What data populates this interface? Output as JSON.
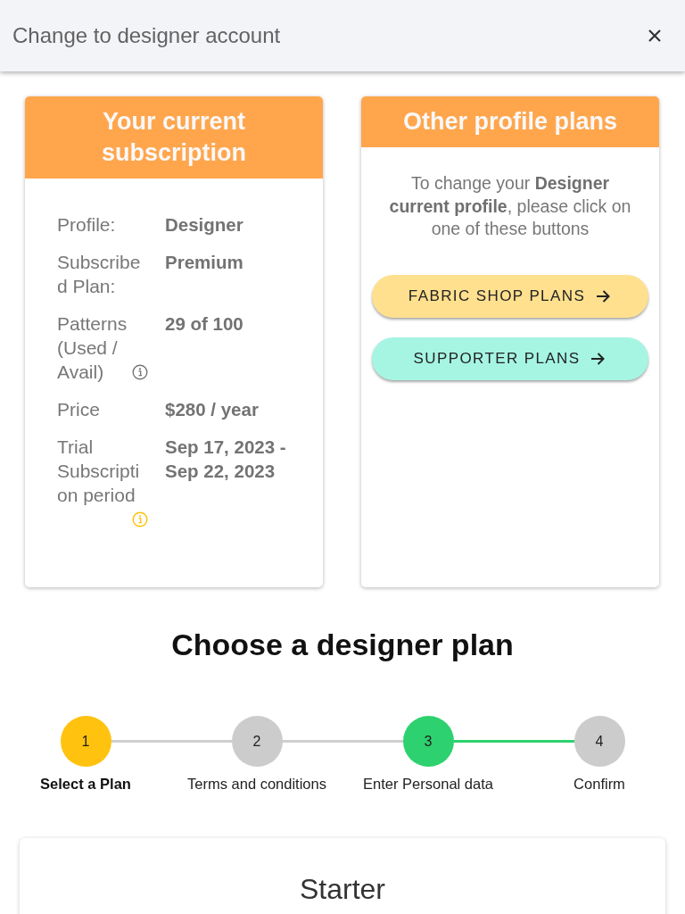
{
  "dialog": {
    "title": "Change to designer account"
  },
  "current_subscription": {
    "title": "Your current subscription",
    "rows": [
      {
        "label": "Profile:",
        "value": "Designer"
      },
      {
        "label": "Subscribed Plan:",
        "value": "Premium"
      },
      {
        "label": "Patterns (Used / Avail)",
        "value": "29 of 100",
        "info_icon": {
          "color": "#757575"
        }
      },
      {
        "label": "Price",
        "value": "$280 / year"
      },
      {
        "label": "Trial Subscription period",
        "value": "Sep 17, 2023 - Sep 22, 2023",
        "info_icon": {
          "color": "#ffc107"
        }
      }
    ]
  },
  "other_plans": {
    "title": "Other profile plans",
    "text": "To change your **Designer current profile**, please click on one of these buttons",
    "buttons": [
      {
        "label": "FABRIC SHOP PLANS",
        "color": "#ffe08f"
      },
      {
        "label": "SUPPORTER PLANS",
        "color": "#a6f5e3"
      }
    ]
  },
  "plan_section": {
    "title": "Choose a designer plan"
  },
  "steps": [
    {
      "number": "1",
      "label": "Select a Plan",
      "selected": true,
      "completed": false
    },
    {
      "number": "2",
      "label": "Terms and conditions",
      "selected": false,
      "completed": false
    },
    {
      "number": "3",
      "label": "Enter Personal data",
      "selected": false,
      "completed": true
    },
    {
      "number": "4",
      "label": "Confirm",
      "selected": false,
      "completed": false
    }
  ],
  "plan_card": {
    "title": "Starter"
  }
}
